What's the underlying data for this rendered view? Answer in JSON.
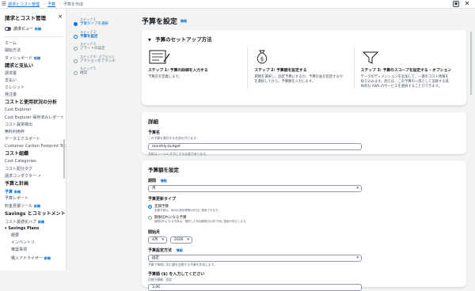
{
  "topbar": {
    "crumbs": [
      "請求とコスト管理",
      "予算"
    ],
    "current": "予算を作成"
  },
  "sidebar": {
    "title": "請求とコスト管理",
    "toggle_label": "請求ビュー",
    "new_badge": "新機",
    "items": [
      {
        "type": "item",
        "label": "ホーム"
      },
      {
        "type": "item",
        "label": "開始方法"
      },
      {
        "type": "item",
        "label": "ダッシュボード",
        "badge": "新機"
      },
      {
        "type": "sec",
        "label": "請求と支払い"
      },
      {
        "type": "item",
        "label": "請求書"
      },
      {
        "type": "item",
        "label": "支払い"
      },
      {
        "type": "item",
        "label": "クレジット"
      },
      {
        "type": "item",
        "label": "発注書"
      },
      {
        "type": "sec",
        "label": "コストと使用状況の分析"
      },
      {
        "type": "item",
        "label": "Cost Explorer"
      },
      {
        "type": "item",
        "label": "Cost Explorer 保存済みレポート"
      },
      {
        "type": "item",
        "label": "コスト異常検出"
      },
      {
        "type": "item",
        "label": "無料利用枠"
      },
      {
        "type": "item",
        "label": "データエクスポート"
      },
      {
        "type": "item",
        "label": "Customer Carbon Footprint Tool"
      },
      {
        "type": "sec",
        "label": "コスト組織"
      },
      {
        "type": "item",
        "label": "Cost Categories"
      },
      {
        "type": "item",
        "label": "コスト配分タグ"
      },
      {
        "type": "item",
        "label": "請求コンダクター",
        "ext": true
      },
      {
        "type": "sec",
        "label": "予算と計画"
      },
      {
        "type": "active",
        "label": "予算",
        "badge": "新機"
      },
      {
        "type": "item",
        "label": "予算レポート"
      },
      {
        "type": "item",
        "label": "料金見積ツール",
        "badge": "新機"
      },
      {
        "type": "sec",
        "label": "Savings とコミットメント"
      },
      {
        "type": "item",
        "label": "コスト最適化ハブ",
        "badge": "新機"
      },
      {
        "type": "group",
        "label": "▾ Savings Plans"
      },
      {
        "type": "sub",
        "label": "概要"
      },
      {
        "type": "sub",
        "label": "インベントリ"
      },
      {
        "type": "sub",
        "label": "推奨事項"
      },
      {
        "type": "sub",
        "label": "購入アナライザー",
        "badge": "新機"
      }
    ]
  },
  "steps": [
    {
      "num": "ステップ 1",
      "label": "予算タイプを選択",
      "state": "done"
    },
    {
      "num": "ステップ 2",
      "label": "予算を設定",
      "state": "cur"
    },
    {
      "num": "ステップ 3",
      "label": "アラートの設定",
      "state": "todo"
    },
    {
      "num": "ステップ 4 - オプション",
      "label": "アクションをアタッチ",
      "state": "todo"
    },
    {
      "num": "ステップ 5",
      "label": "確認",
      "state": "todo"
    }
  ],
  "main": {
    "title": "予算を設定",
    "info": "情報",
    "method": {
      "header": "予算のセットアップ方法",
      "cols": [
        {
          "title": "ステップ 1: 予算の詳細を入力する",
          "desc": "予算名を定義します。"
        },
        {
          "title": "ステップ 2: 予算額を設定する",
          "desc": "期間を選択し、固定予算にするか、予算計画を指定するかを選択してから、予算額を入力します。"
        },
        {
          "title": "ステップ 3: 予算のスコープを設定する - オプション",
          "desc": "データのディメンションを追加して、一連のコスト情報を絞り込みます。例えば、この予算の一部として追跡する具体的な AWS のサービスを選択することができます。"
        }
      ]
    },
    "details": {
      "header": "詳細",
      "name_label": "予算名",
      "name_desc": "この予算を識別する名前を付けます。",
      "name_value": "monthly-budget",
      "name_hint": "名前は 1～100 文字にする必要があります。"
    },
    "amount": {
      "header": "予算額を設定",
      "period_label": "期間",
      "period_info": "情報",
      "period_value": "月",
      "renew_label": "予算更新タイプ",
      "opt1_label": "定期予算",
      "opt1_desc": "定期予算は、毎月の請求期間の初日に更新されます。",
      "opt2_label": "期限切れになる予算",
      "opt2_desc": "期限切れになる予算は、選択した有効期限日の終了時に更新が停止します。",
      "start_label": "開始月",
      "start_month": "4月",
      "start_year": "2026",
      "method_label": "予算設定方法",
      "method_info": "情報",
      "method_value": "固定",
      "method_desc": "予算で毎期に同じ額を追跡する予算を作成します。",
      "amount_label": "予算額 ($) を入力してください",
      "amount_desc": "月額予算額 - 固定",
      "amount_value": "3.00"
    }
  }
}
